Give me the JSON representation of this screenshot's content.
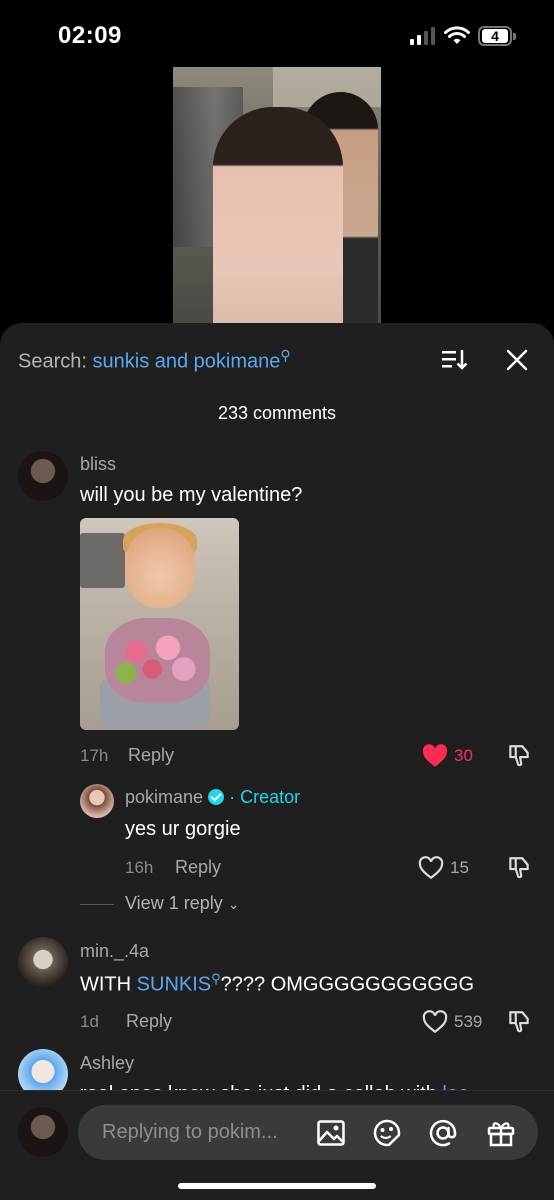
{
  "status_bar": {
    "time": "02:09",
    "battery": "4"
  },
  "header": {
    "search_label": "Search:",
    "search_term": "sunkis and pokimane",
    "comment_count": "233 comments"
  },
  "comments": [
    {
      "username": "bliss",
      "text": "will you be my valentine?",
      "time": "17h",
      "reply_label": "Reply",
      "likes": "30",
      "liked": true
    },
    {
      "username": "pokimane",
      "creator_label": "· Creator",
      "text": "yes ur gorgie",
      "time": "16h",
      "reply_label": "Reply",
      "likes": "15"
    },
    {
      "username": "min._.4a",
      "text_prefix": "WITH ",
      "text_mention": "SUNKIS",
      "text_suffix": "???? OMGGGGGGGGGGG",
      "time": "1d",
      "reply_label": "Reply",
      "likes": "539"
    },
    {
      "username": "Ashley",
      "text": "real ones know she just did a collab with ",
      "text_mention": "lee"
    }
  ],
  "view_replies": "View 1 reply",
  "input": {
    "placeholder": "Replying to pokim..."
  },
  "colors": {
    "accent": "#5aa8f2",
    "like": "#fe2c55",
    "creator": "#20d5ec",
    "sheet": "#1f1f1f"
  }
}
